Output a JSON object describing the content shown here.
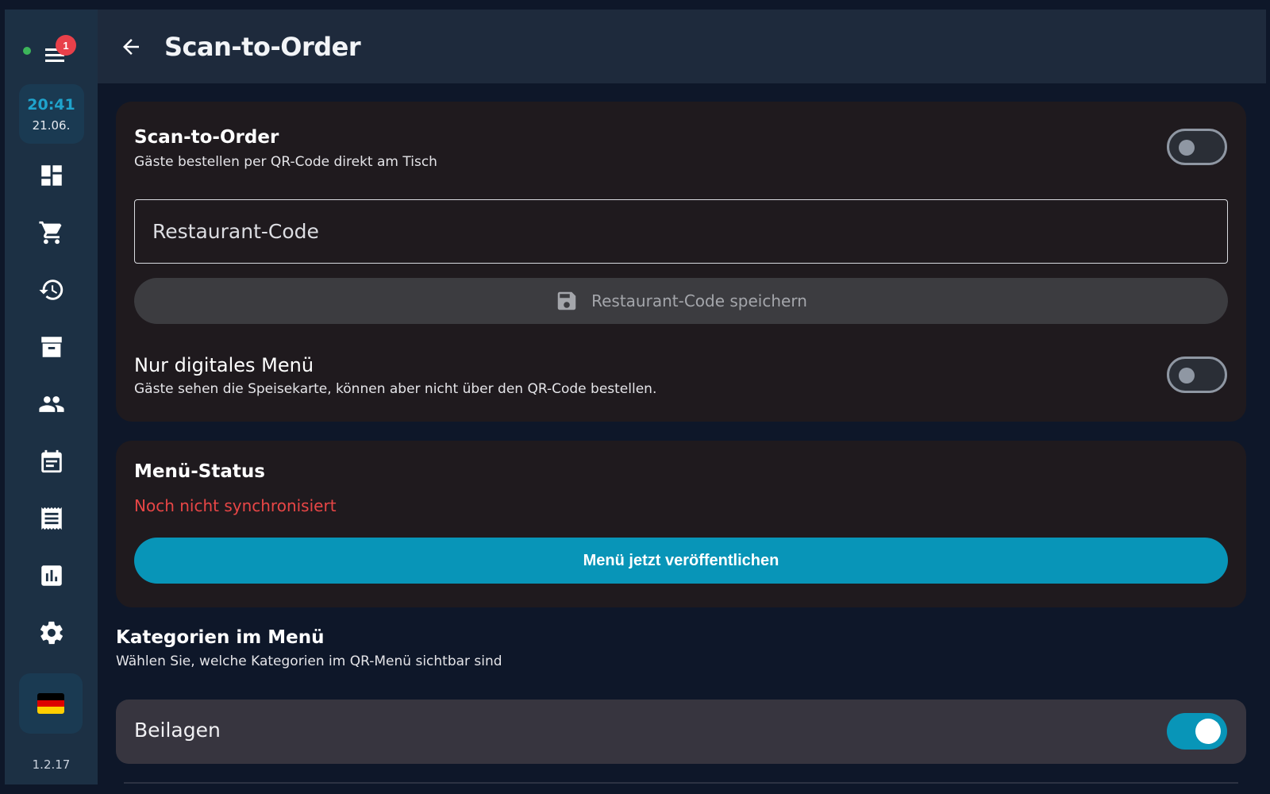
{
  "app": {
    "status": {
      "online": true,
      "online_color": "#3cb55a"
    },
    "notification_count": "1",
    "clock": {
      "time": "20:41",
      "date": "21.06."
    },
    "version": "1.2.17",
    "language": "de"
  },
  "sidebar": {
    "items": [
      {
        "icon": "dashboard-icon"
      },
      {
        "icon": "cart-icon"
      },
      {
        "icon": "history-icon"
      },
      {
        "icon": "archive-icon"
      },
      {
        "icon": "people-icon"
      },
      {
        "icon": "calendar-icon"
      },
      {
        "icon": "receipt-icon"
      },
      {
        "icon": "chart-icon"
      },
      {
        "icon": "gear-icon"
      }
    ]
  },
  "header": {
    "title": "Scan-to-Order"
  },
  "scan_to_order": {
    "title": "Scan-to-Order",
    "subtitle": "Gäste bestellen per QR-Code direkt am Tisch",
    "enabled": false,
    "restaurant_code": {
      "placeholder": "Restaurant-Code",
      "value": ""
    },
    "save_label": "Restaurant-Code speichern",
    "digital_menu_title": "Nur digitales Menü",
    "digital_menu_subtitle": "Gäste sehen die Speisekarte, können aber nicht über den QR-Code bestellen.",
    "digital_menu_enabled": false
  },
  "menu_status": {
    "title": "Menü-Status",
    "status": "Noch nicht synchronisiert",
    "status_color": "#e84646",
    "publish_label": "Menü jetzt veröffentlichen"
  },
  "categories": {
    "title": "Kategorien im Menü",
    "subtitle": "Wählen Sie, welche Kategorien im QR-Menü sichtbar sind",
    "items": [
      {
        "label": "Beilagen",
        "enabled": true
      }
    ]
  },
  "colors": {
    "accent": "#0895b8",
    "background": "#0e1729",
    "card": "#1f1a1e"
  }
}
